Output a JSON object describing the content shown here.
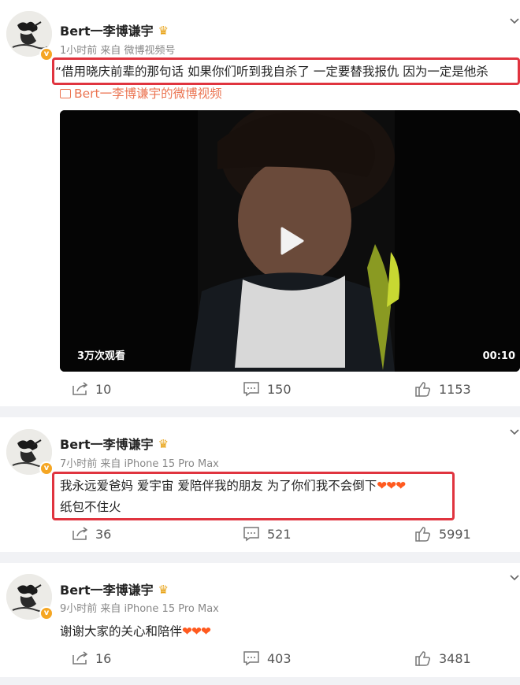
{
  "posts": [
    {
      "username": "Bert一李博谦宇",
      "meta": "1小时前  来自 微博视频号",
      "text": "“借用晓庆前辈的那句话 如果你们听到我自杀了 一定要替我报仇 因为一定是他杀",
      "link_text": "Bert一李博谦宇的微博视频",
      "video": {
        "views": "3万次观看",
        "duration": "00:10"
      },
      "actions": {
        "share": "10",
        "comment": "150",
        "like": "1153"
      }
    },
    {
      "username": "Bert一李博谦宇",
      "meta": "7小时前  来自 iPhone 15 Pro Max",
      "text_line1": "我永远爱爸妈 爱宇宙 爱陪伴我的朋友 为了你们我不会倒下",
      "text_line1_hearts": "❤❤❤",
      "text_line2": "纸包不住火",
      "actions": {
        "share": "36",
        "comment": "521",
        "like": "5991"
      }
    },
    {
      "username": "Bert一李博谦宇",
      "meta": "9小时前  来自 iPhone 15 Pro Max",
      "text": "谢谢大家的关心和陪伴",
      "text_hearts": "❤❤❤",
      "actions": {
        "share": "16",
        "comment": "403",
        "like": "3481"
      }
    }
  ],
  "icons": {
    "share": "share-icon",
    "comment": "comment-icon",
    "like": "thumbs-up-icon",
    "menu": "chevron-down-icon",
    "verified": "verified-badge-icon",
    "crown": "vip-crown-icon",
    "play": "play-icon"
  },
  "colors": {
    "highlight_border": "#e0343f",
    "link": "#eb7350",
    "heart": "#ff5a1f",
    "verified": "#f5a623"
  }
}
